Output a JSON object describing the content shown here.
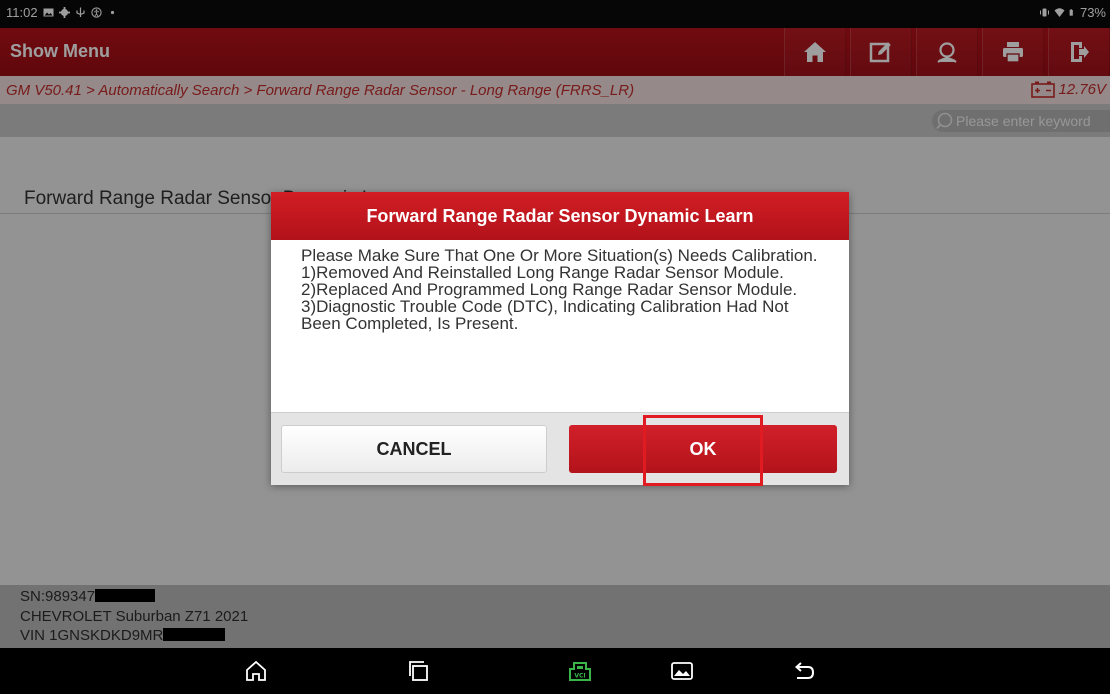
{
  "status_bar": {
    "time": "11:02",
    "battery": "73%"
  },
  "app_bar": {
    "title": "Show Menu"
  },
  "breadcrumb": {
    "path": "GM V50.41 > Automatically Search > Forward Range Radar Sensor - Long Range (FRRS_LR)",
    "voltage": "12.76V"
  },
  "search": {
    "placeholder": "Please enter keyword"
  },
  "function_list": {
    "item": "Forward Range Radar Sensor Dynamic Learn"
  },
  "vehicle_info": {
    "sn": "SN:989347",
    "model": "CHEVROLET Suburban Z71 2021",
    "vin": "VIN 1GNSKDKD9MR"
  },
  "dialog": {
    "title": "Forward Range Radar Sensor Dynamic Learn",
    "message": "Please Make Sure That One Or More Situation(s) Needs Calibration.\n1)Removed And Reinstalled Long Range Radar Sensor Module.\n2)Replaced And Programmed Long Range Radar Sensor Module.\n3)Diagnostic Trouble Code (DTC), Indicating Calibration Had Not Been Completed, Is Present.",
    "cancel_label": "CANCEL",
    "ok_label": "OK"
  },
  "colors": {
    "brand_red": "#b5121b",
    "highlight": "#e11b22"
  }
}
